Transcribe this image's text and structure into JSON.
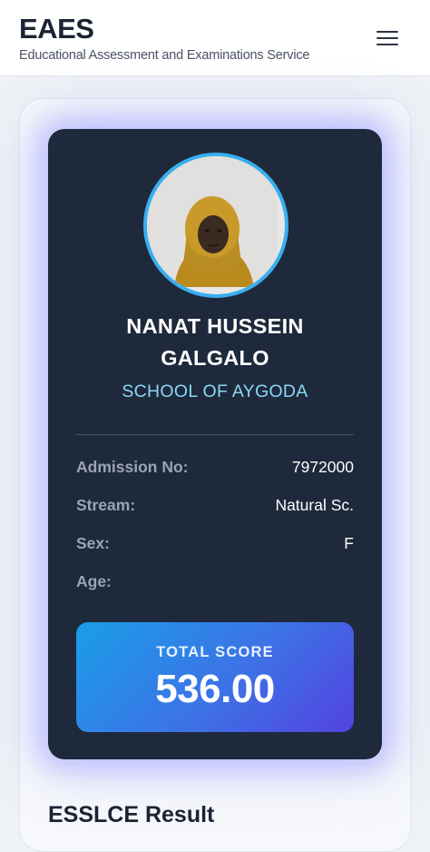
{
  "header": {
    "title": "EAES",
    "subtitle": "Educational Assessment and Examinations Service",
    "menu_icon": "hamburger-menu-icon"
  },
  "student": {
    "name_line1": "NANAT HUSSEIN",
    "name_line2": "GALGALO",
    "school": "SCHOOL OF AYGODA",
    "photo": "student-photo"
  },
  "details": [
    {
      "label": "Admission No:",
      "value": "7972000"
    },
    {
      "label": "Stream:",
      "value": "Natural Sc."
    },
    {
      "label": "Sex:",
      "value": "F"
    },
    {
      "label": "Age:",
      "value": ""
    }
  ],
  "score": {
    "label": "TOTAL SCORE",
    "value": "536.00"
  },
  "result_section": {
    "title": "ESSLCE Result"
  },
  "colors": {
    "card_bg": "#1e293b",
    "avatar_ring": "#38aef0",
    "school_text": "#8ad8f4",
    "score_gradient_start": "#1a9ee8",
    "score_gradient_end": "#5243df"
  }
}
